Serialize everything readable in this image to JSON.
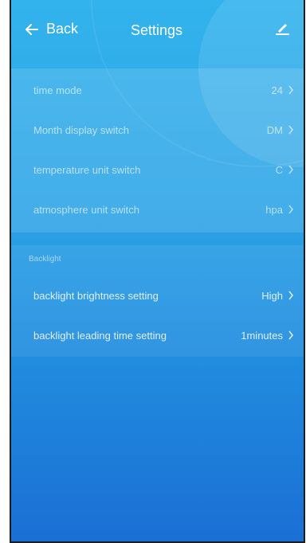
{
  "header": {
    "back_label": "Back",
    "title": "Settings"
  },
  "general_settings": [
    {
      "label": "time mode",
      "value": "24"
    },
    {
      "label": "Month display switch",
      "value": "DM"
    },
    {
      "label": "temperature unit switch",
      "value": "C"
    },
    {
      "label": "atmosphere unit switch",
      "value": "hpa"
    }
  ],
  "backlight": {
    "section_label": "Backlight",
    "items": [
      {
        "label": "backlight brightness setting",
        "value": "High"
      },
      {
        "label": "backlight leading time setting",
        "value": "1minutes"
      }
    ]
  },
  "colors": {
    "background_top": "#33b3ec",
    "background_bottom": "#1b6fd4",
    "text": "#ffffff"
  },
  "icons": {
    "back": "arrow-left-icon",
    "edit": "pencil-icon",
    "chevron": "chevron-right-icon"
  }
}
